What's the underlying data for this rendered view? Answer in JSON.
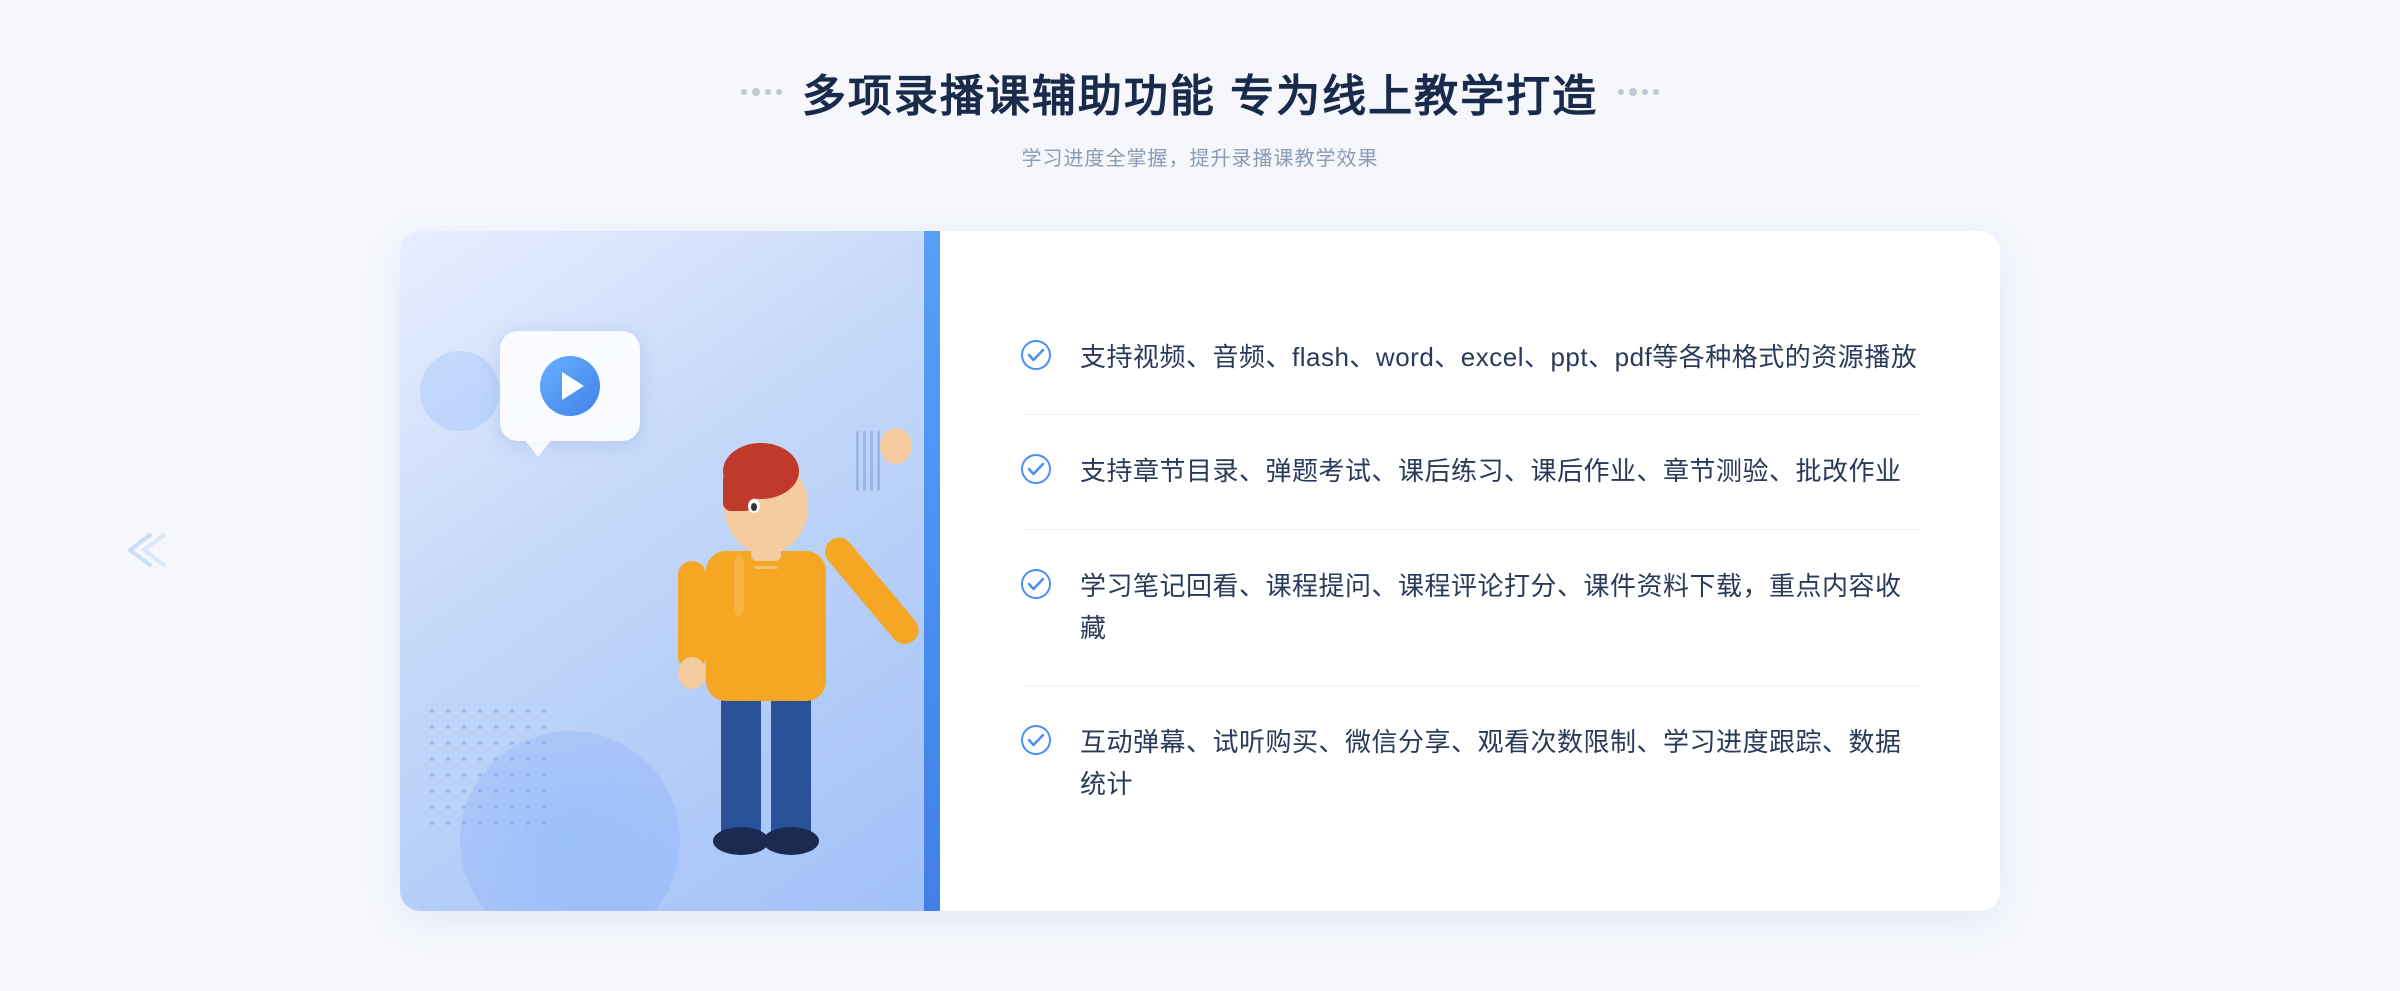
{
  "header": {
    "title": "多项录播课辅助功能 专为线上教学打造",
    "subtitle": "学习进度全掌握，提升录播课教学效果",
    "dots_left": "decorative-dots",
    "dots_right": "decorative-dots"
  },
  "features": [
    {
      "id": 1,
      "text": "支持视频、音频、flash、word、excel、ppt、pdf等各种格式的资源播放"
    },
    {
      "id": 2,
      "text": "支持章节目录、弹题考试、课后练习、课后作业、章节测验、批改作业"
    },
    {
      "id": 3,
      "text": "学习笔记回看、课程提问、课程评论打分、课件资料下载，重点内容收藏"
    },
    {
      "id": 4,
      "text": "互动弹幕、试听购买、微信分享、观看次数限制、学习进度跟踪、数据统计"
    }
  ],
  "colors": {
    "accent_blue": "#4a8ff5",
    "title_color": "#1a2a4a",
    "text_color": "#2a3a5a",
    "subtitle_color": "#8a9bb5",
    "check_color": "#4a8ff5",
    "border_color": "#f0f3f8"
  }
}
